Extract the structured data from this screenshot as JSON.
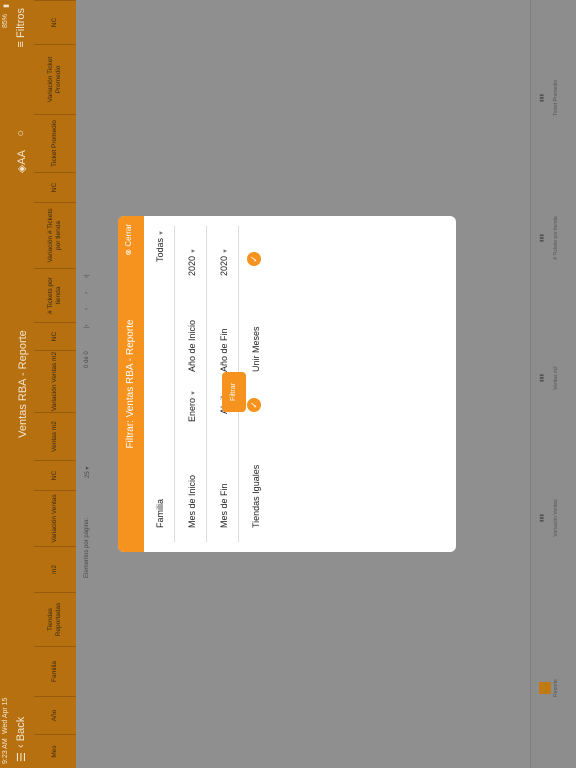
{
  "status": {
    "time": "9:23 AM",
    "date": "Wed Apr 15",
    "battery": "85%"
  },
  "nav": {
    "back_label": "Back",
    "title": "Ventas RBA - Reporte",
    "filters_label": "Filtros",
    "aa_label": "AA"
  },
  "columns": [
    "Mes",
    "Año",
    "Familia",
    "Tiendas Reportadas",
    "m2",
    "Variación Ventas",
    "NC",
    "Ventas m2",
    "Variación Ventas m2",
    "NC",
    "# Tickets por tienda",
    "Variación # Tickets por tienda",
    "NC",
    "Ticket Promedio",
    "Variación Ticket Promedio",
    "NC"
  ],
  "pagination": {
    "per_page_label": "Elementos por página:",
    "per_page_value": "25",
    "range": "0 de 0"
  },
  "tabs": [
    "Reporte",
    "Variación Ventas",
    "Ventas m2",
    "# Tickets por tienda",
    "Ticket Promedio"
  ],
  "modal": {
    "title": "Filtrar: Ventas RBA - Reporte",
    "close_label": "Cerrar",
    "familia_label": "Familia",
    "familia_value": "Todas",
    "mes_inicio_label": "Mes de Inicio",
    "mes_inicio_value": "Enero",
    "anio_inicio_label": "Año de Inicio",
    "anio_inicio_value": "2020",
    "mes_fin_label": "Mes de Fin",
    "mes_fin_value": "Abril",
    "anio_fin_label": "Año de Fin",
    "anio_fin_value": "2020",
    "tiendas_label": "Tiendas Iguales",
    "unir_label": "Unir Meses",
    "filter_button": "Filtrar"
  },
  "colors": {
    "header": "#b7700f",
    "accent": "#f6921e",
    "overlay": "#8f8f8f"
  }
}
